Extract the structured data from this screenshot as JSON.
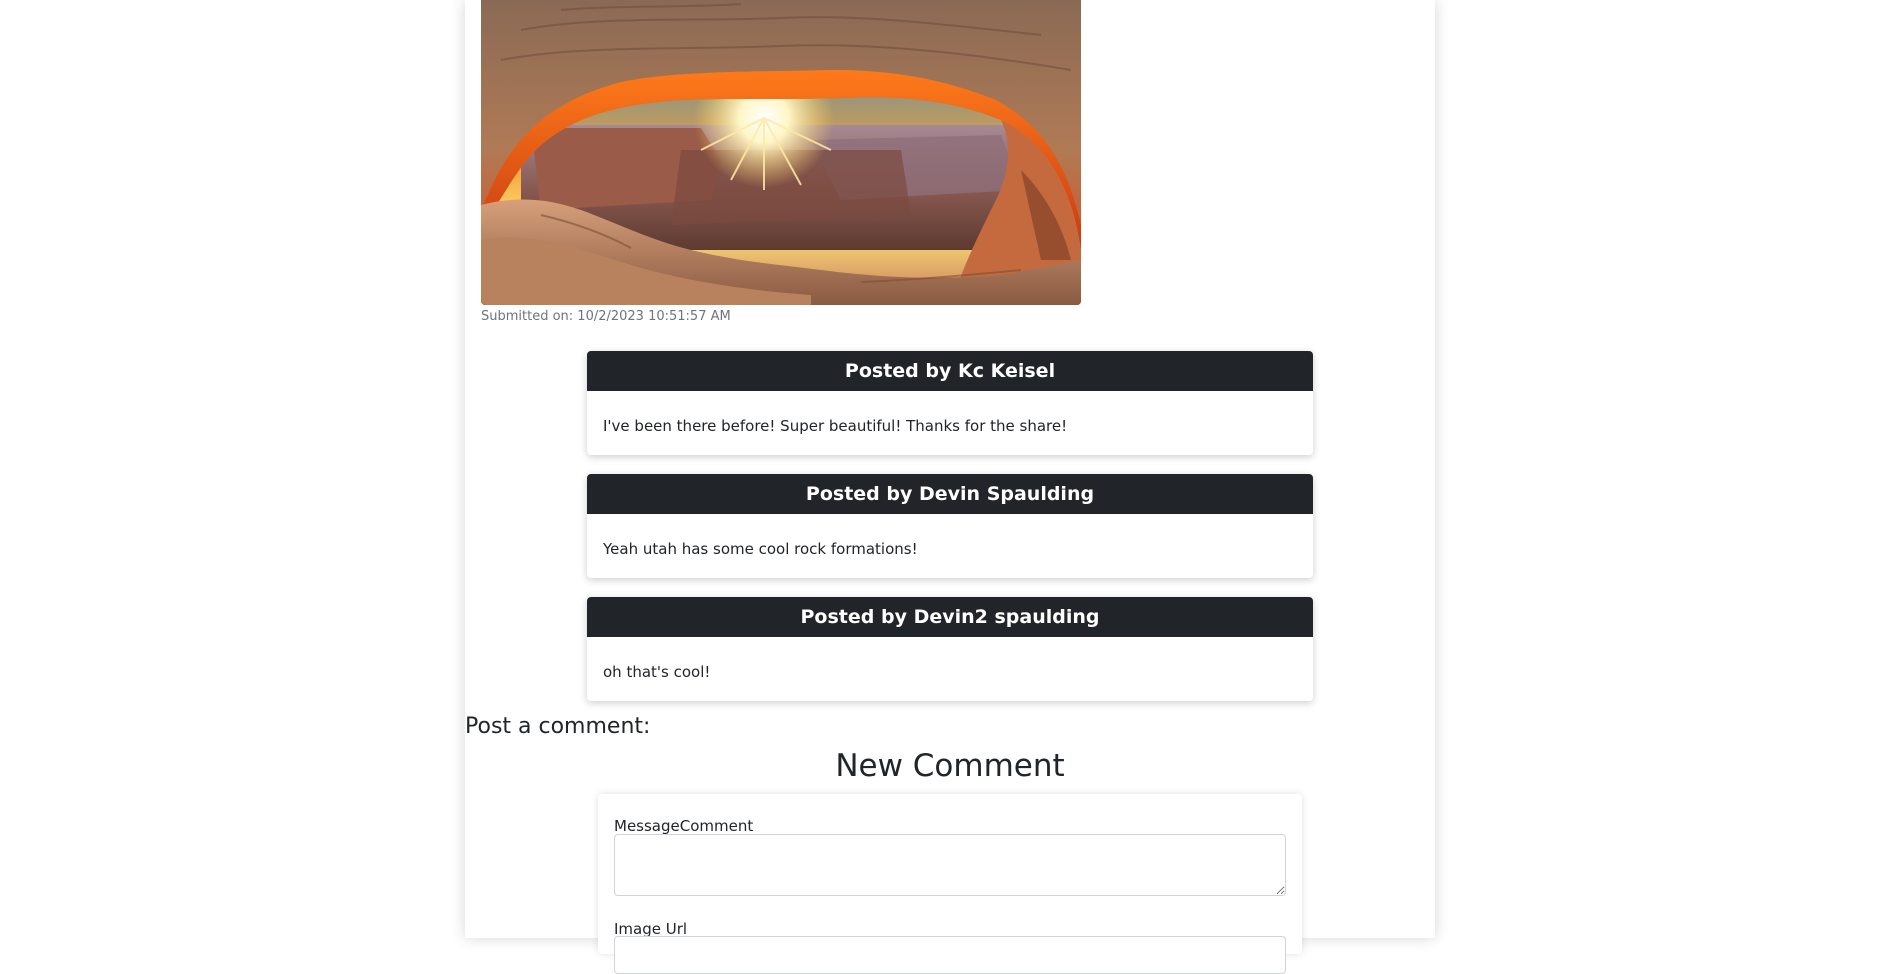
{
  "post": {
    "image_alt": "Sunrise through a desert stone arch overlooking a canyon",
    "submitted_text": "Submitted on: 10/2/2023 10:51:57 AM"
  },
  "comments": [
    {
      "header": "Posted by Kc Keisel",
      "message": "I've been there before! Super beautiful! Thanks for the share!"
    },
    {
      "header": "Posted by Devin Spaulding",
      "message": "Yeah utah has some cool rock formations!"
    },
    {
      "header": "Posted by Devin2 spaulding",
      "message": "oh that's cool!"
    }
  ],
  "form": {
    "section_label": "Post a comment:",
    "title": "New Comment",
    "message_label": "MessageComment",
    "message_value": "",
    "image_url_label": "Image Url",
    "image_url_value": ""
  },
  "colors": {
    "card_header_bg": "#212529",
    "muted_text": "#6c757d",
    "input_border": "#ced4da"
  }
}
